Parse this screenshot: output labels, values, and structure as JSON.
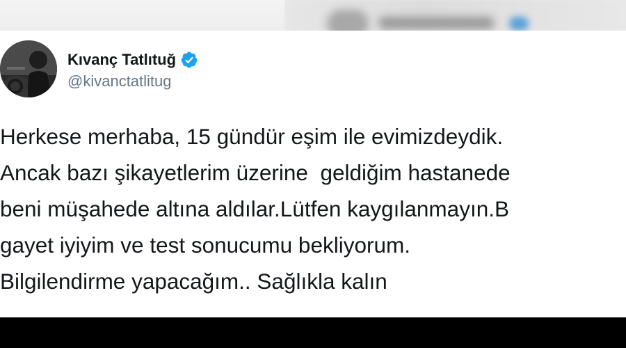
{
  "tweet": {
    "display_name": "Kıvanç Tatlıtuğ",
    "handle": "@kivanctatlitug",
    "verified": true,
    "lines": [
      "Herkese merhaba, 15 gündür eşim ile evimizdeydik.",
      "Ancak bazı şikayetlerim üzerine  geldiğim hastanede",
      "beni müşahede altına aldılar.Lütfen kaygılanmayın.B",
      "gayet iyiyim ve test sonucumu bekliyorum.",
      "Bilgilendirme yapacağım.. Sağlıkla kalın"
    ]
  },
  "icons": {
    "verified_badge": "verified-badge-icon",
    "avatar": "profile-photo"
  },
  "colors": {
    "verified_blue": "#1da1f2",
    "text": "#14171a",
    "handle": "#657786",
    "bottom_bar": "#000000"
  }
}
